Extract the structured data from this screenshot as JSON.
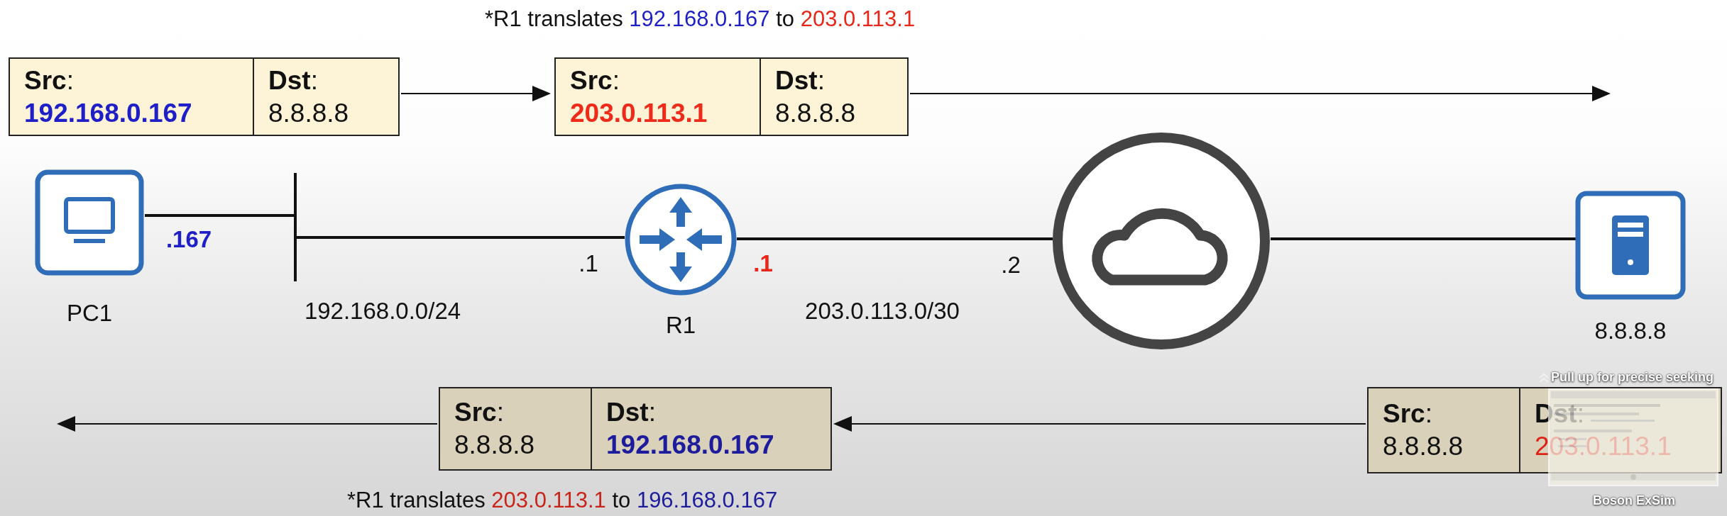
{
  "top_caption": {
    "segments": [
      {
        "text": "*R1 translates ",
        "color": "#111111"
      },
      {
        "text": "192.168.0.167",
        "color": "#1f1fc8"
      },
      {
        "text": " to ",
        "color": "#111111"
      },
      {
        "text": "203.0.113.1",
        "color": "#e8261a"
      }
    ]
  },
  "packets": [
    {
      "kind": "outbound",
      "src": {
        "label": "**Src**:",
        "value": "192.168.0.167",
        "color": "#1f1fc8",
        "bold": true
      },
      "dst": {
        "label": "**Dst**:",
        "value": "8.8.8.8",
        "color": "#111111",
        "bold": false
      }
    },
    {
      "kind": "outbound",
      "src": {
        "label": "**Src**:",
        "value": "203.0.113.1",
        "color": "#ee2a1a",
        "bold": true
      },
      "dst": {
        "label": "**Dst**:",
        "value": "8.8.8.8",
        "color": "#111111",
        "bold": false
      }
    },
    {
      "kind": "inbound",
      "src": {
        "label": "**Src**:",
        "value": "8.8.8.8",
        "color": "#111111",
        "bold": false
      },
      "dst": {
        "label": "**Dst**:",
        "value": "192.168.0.167",
        "color": "#1c1c9c",
        "bold": true
      }
    },
    {
      "kind": "inbound",
      "src": {
        "label": "**Src**:",
        "value": "8.8.8.8",
        "color": "#111111",
        "bold": false
      },
      "dst": {
        "label": "**Dst**:",
        "value": "203.0.113.1",
        "color": "#dd2416",
        "bold": false
      }
    }
  ],
  "nodes": [
    {
      "kind": "pc",
      "label": "PC1"
    },
    {
      "kind": "router",
      "label": "R1"
    },
    {
      "kind": "cloud"
    },
    {
      "kind": "server",
      "label": "8.8.8.8"
    }
  ],
  "interface_labels": [
    {
      "text": ".167",
      "color": "#1f1fc8",
      "bold": true
    },
    {
      "text": ".1",
      "color": "#111111",
      "bold": false
    },
    {
      "text": ".1",
      "color": "#e8261a",
      "bold": true
    },
    {
      "text": ".2",
      "color": "#111111",
      "bold": false
    }
  ],
  "network_labels": [
    "192.168.0.0/24",
    "203.0.113.0/30"
  ],
  "bottom_caption": {
    "segments": [
      {
        "text": "*R1 translates ",
        "color": "#111111"
      },
      {
        "text": "203.0.113.1",
        "color": "#c8241a"
      },
      {
        "text": " to ",
        "color": "#111111"
      },
      {
        "text": "196.168.0.167",
        "color": "#1c1c9c"
      }
    ]
  },
  "seek_preview": {
    "hint": "Pull up for precise seeking",
    "title": "Boson ExSim"
  }
}
